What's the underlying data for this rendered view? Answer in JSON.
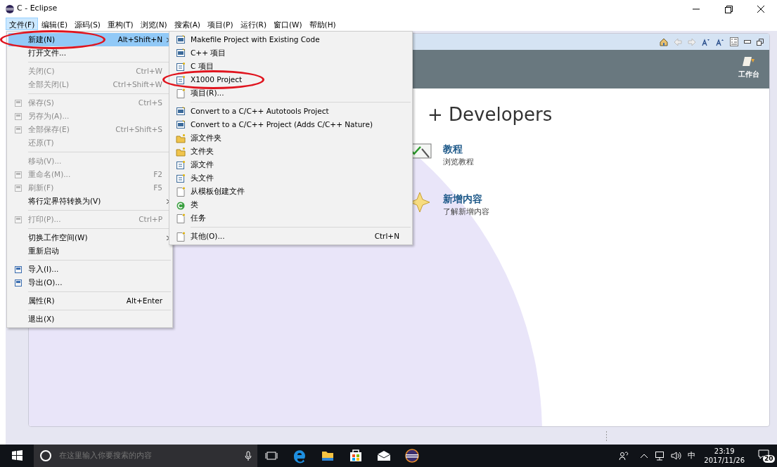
{
  "window": {
    "title": "C - Eclipse"
  },
  "menu_bar": [
    {
      "label": "文件(F)",
      "selected": true
    },
    {
      "label": "编辑(E)",
      "selected": false
    },
    {
      "label": "源码(S)",
      "selected": false
    },
    {
      "label": "重构(T)",
      "selected": false
    },
    {
      "label": "浏览(N)",
      "selected": false
    },
    {
      "label": "搜索(A)",
      "selected": false
    },
    {
      "label": "项目(P)",
      "selected": false
    },
    {
      "label": "运行(R)",
      "selected": false
    },
    {
      "label": "窗口(W)",
      "selected": false
    },
    {
      "label": "帮助(H)",
      "selected": false
    }
  ],
  "file_menu": [
    {
      "kind": "item",
      "label": "新建(N)",
      "shortcut": "Alt+Shift+N",
      "submenu": true,
      "disabled": false,
      "selected": true,
      "circled": true,
      "has_icon": false
    },
    {
      "kind": "item",
      "label": "打开文件...",
      "disabled": false,
      "selected": false,
      "circled": false,
      "has_icon": false
    },
    {
      "kind": "separator"
    },
    {
      "kind": "item",
      "label": "关闭(C)",
      "shortcut": "Ctrl+W",
      "disabled": true,
      "selected": false,
      "circled": false,
      "has_icon": false
    },
    {
      "kind": "item",
      "label": "全部关闭(L)",
      "shortcut": "Ctrl+Shift+W",
      "disabled": true,
      "selected": false,
      "circled": false,
      "has_icon": false
    },
    {
      "kind": "separator"
    },
    {
      "kind": "item",
      "label": "保存(S)",
      "shortcut": "Ctrl+S",
      "disabled": true,
      "selected": false,
      "circled": false,
      "has_icon": true
    },
    {
      "kind": "item",
      "label": "另存为(A)...",
      "disabled": true,
      "selected": false,
      "circled": false,
      "has_icon": true
    },
    {
      "kind": "item",
      "label": "全部保存(E)",
      "shortcut": "Ctrl+Shift+S",
      "disabled": true,
      "selected": false,
      "circled": false,
      "has_icon": true
    },
    {
      "kind": "item",
      "label": "还原(T)",
      "disabled": true,
      "selected": false,
      "circled": false,
      "has_icon": false
    },
    {
      "kind": "separator"
    },
    {
      "kind": "item",
      "label": "移动(V)...",
      "disabled": true,
      "selected": false,
      "circled": false,
      "has_icon": false
    },
    {
      "kind": "item",
      "label": "重命名(M)...",
      "shortcut": "F2",
      "disabled": true,
      "selected": false,
      "circled": false,
      "has_icon": true
    },
    {
      "kind": "item",
      "label": "刷新(F)",
      "shortcut": "F5",
      "disabled": true,
      "selected": false,
      "circled": false,
      "has_icon": true
    },
    {
      "kind": "item",
      "label": "将行定界符转换为(V)",
      "submenu": true,
      "disabled": false,
      "selected": false,
      "circled": false,
      "has_icon": false
    },
    {
      "kind": "separator"
    },
    {
      "kind": "item",
      "label": "打印(P)...",
      "shortcut": "Ctrl+P",
      "disabled": true,
      "selected": false,
      "circled": false,
      "has_icon": true
    },
    {
      "kind": "separator"
    },
    {
      "kind": "item",
      "label": "切换工作空间(W)",
      "submenu": true,
      "disabled": false,
      "selected": false,
      "circled": false,
      "has_icon": false
    },
    {
      "kind": "item",
      "label": "重新启动",
      "disabled": false,
      "selected": false,
      "circled": false,
      "has_icon": false
    },
    {
      "kind": "separator"
    },
    {
      "kind": "item",
      "label": "导入(I)...",
      "disabled": false,
      "selected": false,
      "circled": false,
      "has_icon": true
    },
    {
      "kind": "item",
      "label": "导出(O)...",
      "disabled": false,
      "selected": false,
      "circled": false,
      "has_icon": true
    },
    {
      "kind": "separator"
    },
    {
      "kind": "item",
      "label": "属性(R)",
      "shortcut": "Alt+Enter",
      "disabled": false,
      "selected": false,
      "circled": false,
      "has_icon": false
    },
    {
      "kind": "separator"
    },
    {
      "kind": "item",
      "label": "退出(X)",
      "disabled": false,
      "selected": false,
      "circled": false,
      "has_icon": false
    }
  ],
  "new_submenu": [
    {
      "kind": "item",
      "label": "Makefile Project with Existing Code",
      "circled": false
    },
    {
      "kind": "item",
      "label": "C++ 项目",
      "circled": false
    },
    {
      "kind": "item",
      "label": "C 项目",
      "circled": false
    },
    {
      "kind": "item",
      "label": "X1000 Project",
      "circled": true
    },
    {
      "kind": "item",
      "label": "项目(R)...",
      "circled": false
    },
    {
      "kind": "separator"
    },
    {
      "kind": "item",
      "label": "Convert to a C/C++ Autotools Project",
      "circled": false
    },
    {
      "kind": "item",
      "label": "Convert to a C/C++ Project (Adds C/C++ Nature)",
      "circled": false
    },
    {
      "kind": "item",
      "label": "源文件夹",
      "circled": false
    },
    {
      "kind": "item",
      "label": "文件夹",
      "circled": false
    },
    {
      "kind": "item",
      "label": "源文件",
      "circled": false
    },
    {
      "kind": "item",
      "label": "头文件",
      "circled": false
    },
    {
      "kind": "item",
      "label": "从模板创建文件",
      "circled": false
    },
    {
      "kind": "item",
      "label": "类",
      "circled": false
    },
    {
      "kind": "item",
      "label": "任务",
      "circled": false
    },
    {
      "kind": "separator"
    },
    {
      "kind": "item",
      "label": "其他(O)...",
      "shortcut": "Ctrl+N",
      "circled": false
    }
  ],
  "welcome": {
    "header_button": "工作台",
    "heading": "+ Developers",
    "links": [
      {
        "title": "教程",
        "description": "浏览教程"
      },
      {
        "title": "新增内容",
        "description": "了解新增内容"
      }
    ]
  },
  "taskbar": {
    "search_placeholder": "在这里输入你要搜索的内容",
    "ime": "中",
    "time": "23:19",
    "date": "2017/11/26",
    "notifications": "20"
  }
}
